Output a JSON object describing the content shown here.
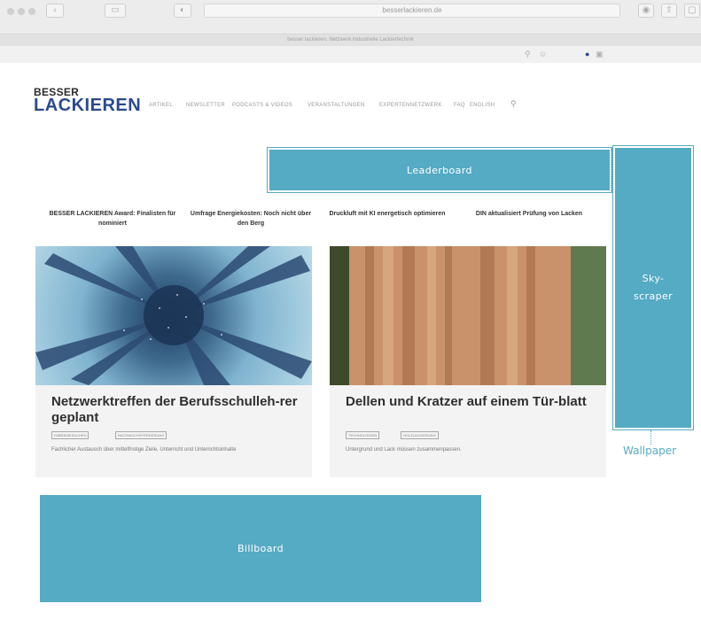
{
  "browser": {
    "url": "besserlackieren.de",
    "tab_title": "besser lackieren: Netzwerk industrielle Lackiertechnik"
  },
  "site": {
    "logo_line1": "BESSER",
    "logo_line2": "LACKIEREN",
    "nav": [
      "ARTIKEL",
      "NEWSLETTER",
      "PODCASTS & VIDEOS",
      "VERANSTALTUNGEN",
      "EXPERTENNETZWERK",
      "FAQ",
      "ENGLISH"
    ]
  },
  "ads": {
    "leaderboard": "Leaderboard",
    "skyscraper": "Sky-\nscraper",
    "wallpaper": "Wallpaper",
    "billboard": "Billboard"
  },
  "teasers": [
    "BESSER LACKIEREN Award: Finalisten für nominiert",
    "Umfrage Energiekosten: Noch nicht über den Berg",
    "Druckluft mit KI energetisch optimieren",
    "DIN aktualisiert Prüfung von Lacken"
  ],
  "articles": [
    {
      "title": "Netzwerktreffen der Berufsschulleh-rer geplant",
      "tags": [
        "FABRIKBESUCHEN",
        "NACHWUCHSFÖRDERUNG"
      ],
      "text": "Fachlicher Austausch über mittelfristige Ziele, Unterricht und Unterrichtsinhalte"
    },
    {
      "title": "Dellen und Kratzer auf einem Tür-blatt",
      "tags": [
        "TECHNOLOGIEN",
        "HOLZLACKIERUNG"
      ],
      "text": "Untergrund und Lack müssen zusammenpassen."
    }
  ],
  "colors": {
    "ad_blue": "#55aac4",
    "logo_blue": "#2a4a8e"
  }
}
